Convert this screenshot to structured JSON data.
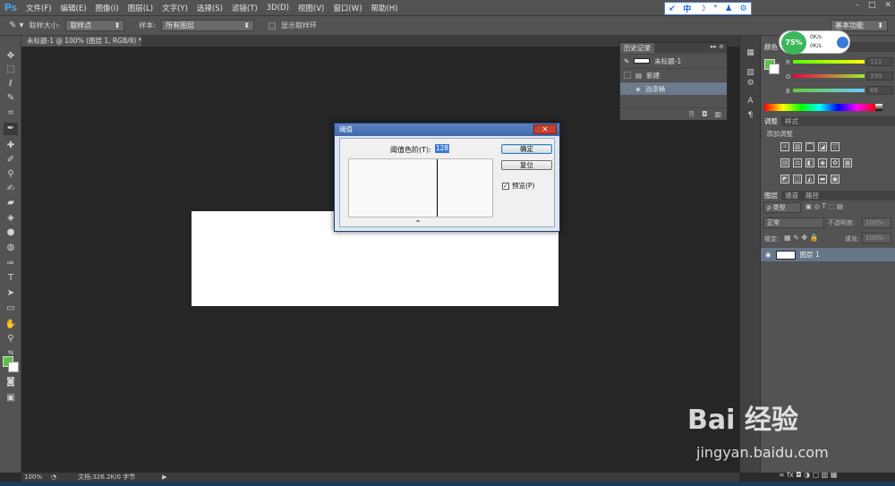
{
  "app": {
    "logo": "Ps"
  },
  "menu": [
    "文件(F)",
    "编辑(E)",
    "图像(I)",
    "图层(L)",
    "文字(Y)",
    "选择(S)",
    "滤镜(T)",
    "3D(D)",
    "视图(V)",
    "窗口(W)",
    "帮助(H)"
  ],
  "ime": {
    "items": [
      "↙",
      "中",
      "☽",
      "°",
      "♟",
      "⚙"
    ]
  },
  "window_controls": [
    "–",
    "□",
    "✕"
  ],
  "options": {
    "sample_size_label": "取样大小:",
    "sample_size_value": "取样点",
    "sample_label": "样本:",
    "sample_value": "所有图层",
    "show_ring_label": "显示取样环",
    "workspace_value": "基本功能"
  },
  "document": {
    "tab_title": "未标题-1 @ 100% (图层 1, RGB/8) *",
    "tab_close": "×"
  },
  "statusbar": {
    "zoom": "100%",
    "doc_info": "文档:326.2K/0 字节"
  },
  "history": {
    "tab": "历史记录",
    "snapshot": "未标题-1",
    "items": [
      "新建",
      "油漆桶"
    ]
  },
  "network": {
    "percent": "75%",
    "up": "0K/s",
    "down": "0K/s"
  },
  "color_panel": {
    "tabs": [
      "颜色"
    ],
    "channels": [
      {
        "label": "R",
        "value": "111"
      },
      {
        "label": "G",
        "value": "199"
      },
      {
        "label": "B",
        "value": "68"
      }
    ],
    "fg_color": "#5cc246",
    "bg_color": "#ffffff"
  },
  "adjust_panel": {
    "tabs": [
      "调整",
      "样式"
    ],
    "title": "添加调整"
  },
  "layers_panel": {
    "tabs": [
      "图层",
      "通道",
      "路径"
    ],
    "kind_label": "ρ 类型",
    "blend_mode": "正常",
    "opacity_label": "不透明度:",
    "opacity_value": "100%",
    "lock_label": "锁定:",
    "fill_label": "填充:",
    "fill_value": "100%",
    "layer_name": "图层 1"
  },
  "dialog": {
    "title": "阈值",
    "close": "✕",
    "threshold_label": "阈值色阶(T):",
    "threshold_value": "128",
    "ok": "确定",
    "reset": "复位",
    "preview": "预览(P)",
    "preview_checked": "✓"
  },
  "watermark": {
    "brand": "Bai 经验",
    "url": "jingyan.baidu.com"
  }
}
